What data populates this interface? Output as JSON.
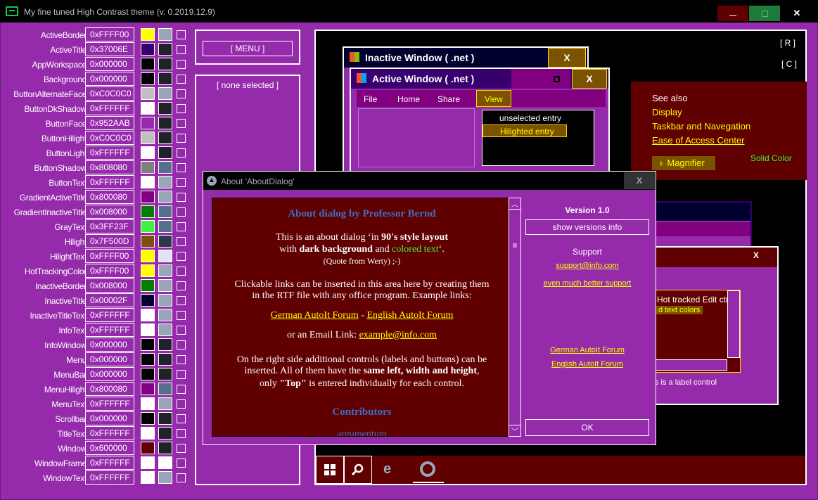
{
  "app": {
    "title": "My fine tuned High Contrast theme (v. 0.2019.12.9)"
  },
  "colors": [
    {
      "name": "ActiveBorder",
      "value": "0xFFFF00",
      "c1": "#FFFF00",
      "c2": "#9aa6b8"
    },
    {
      "name": "ActiveTitle",
      "value": "0x37006E",
      "c1": "#37006E",
      "c2": "#1f2328"
    },
    {
      "name": "AppWorkspace",
      "value": "0x000000",
      "c1": "#000000",
      "c2": "#1f2328"
    },
    {
      "name": "Background",
      "value": "0x000000",
      "c1": "#000000",
      "c2": "#1f2328"
    },
    {
      "name": "ButtonAlternateFace",
      "value": "0xC0C0C0",
      "c1": "#C0C0C0",
      "c2": "#9aa6b8"
    },
    {
      "name": "ButtonDkShadow",
      "value": "0xFFFFFF",
      "c1": "#FFFFFF",
      "c2": "#1f2328"
    },
    {
      "name": "ButtonFace",
      "value": "0x952AAB",
      "c1": "#952AAB",
      "c2": "#1f2328"
    },
    {
      "name": "ButtonHilight",
      "value": "0xC0C0C0",
      "c1": "#C0C0C0",
      "c2": "#1f2328"
    },
    {
      "name": "ButtonLight",
      "value": "0xFFFFFF",
      "c1": "#FFFFFF",
      "c2": "#1f2328"
    },
    {
      "name": "ButtonShadow",
      "value": "0x808080",
      "c1": "#808080",
      "c2": "#55708a"
    },
    {
      "name": "ButtonText",
      "value": "0xFFFFFF",
      "c1": "#FFFFFF",
      "c2": "#9aa6b8"
    },
    {
      "name": "GradientActiveTitle",
      "value": "0x800080",
      "c1": "#800080",
      "c2": "#9aa6b8"
    },
    {
      "name": "GradientInactiveTitle",
      "value": "0x008000",
      "c1": "#008000",
      "c2": "#55708a"
    },
    {
      "name": "GrayText",
      "value": "0x3FF23F",
      "c1": "#3FF23F",
      "c2": "#55708a"
    },
    {
      "name": "Hilight",
      "value": "0x7F500D",
      "c1": "#7F500D",
      "c2": "#2d3848"
    },
    {
      "name": "HilightText",
      "value": "0xFFFF00",
      "c1": "#FFFF00",
      "c2": "#dfe4ee"
    },
    {
      "name": "HotTrackingColor",
      "value": "0xFFFF00",
      "c1": "#FFFF00",
      "c2": "#9aa6b8"
    },
    {
      "name": "InactiveBorder",
      "value": "0x008000",
      "c1": "#008000",
      "c2": "#9aa6b8"
    },
    {
      "name": "InactiveTitle",
      "value": "0x00002F",
      "c1": "#00002F",
      "c2": "#9aa6b8"
    },
    {
      "name": "InactiveTitleText",
      "value": "0xFFFFFF",
      "c1": "#FFFFFF",
      "c2": "#9aa6b8"
    },
    {
      "name": "InfoText",
      "value": "0xFFFFFF",
      "c1": "#FFFFFF",
      "c2": "#9aa6b8"
    },
    {
      "name": "InfoWindow",
      "value": "0x000000",
      "c1": "#000000",
      "c2": "#1f2328"
    },
    {
      "name": "Menu",
      "value": "0x000000",
      "c1": "#000000",
      "c2": "#1f2328"
    },
    {
      "name": "MenuBar",
      "value": "0x000000",
      "c1": "#000000",
      "c2": "#1f2328"
    },
    {
      "name": "MenuHilight",
      "value": "0x800080",
      "c1": "#800080",
      "c2": "#55708a"
    },
    {
      "name": "MenuText",
      "value": "0xFFFFFF",
      "c1": "#FFFFFF",
      "c2": "#9aa6b8"
    },
    {
      "name": "Scrollbar",
      "value": "0x000000",
      "c1": "#000000",
      "c2": "#1f2328"
    },
    {
      "name": "TitleText",
      "value": "0xFFFFFF",
      "c1": "#FFFFFF",
      "c2": "#1f2328"
    },
    {
      "name": "Window",
      "value": "0x600000",
      "c1": "#600000",
      "c2": "#1f2328"
    },
    {
      "name": "WindowFrame",
      "value": "0xFFFFFF",
      "c1": "#FFFFFF",
      "c2": "#FFFFFF"
    },
    {
      "name": "WindowText",
      "value": "0xFFFFFF",
      "c1": "#FFFFFF",
      "c2": "#9aa6b8"
    }
  ],
  "menu_button": "[ MENU ]",
  "selection_label": "[ none selected ]",
  "preview": {
    "btn_r": "[ R ]",
    "btn_c": "[ C ]",
    "inactive_title": "Inactive Window ( .net )",
    "active_title": "Active Window ( .net )",
    "close_glyph": "X",
    "ribbon_tabs": [
      "File",
      "Home",
      "Share",
      "View"
    ],
    "list_unselected": "unselected entry",
    "list_highlighted": "Hilighted entry",
    "see_also": "See also",
    "links": [
      "Display",
      "Taskbar and Navegation",
      "Ease of Access Center"
    ],
    "magnifier": "Magnifier",
    "solid_color": "Solid Color",
    "edit_hot": "Hot tracked Edit ctrl.",
    "edit_colors": "d text colors",
    "label_ctrl": "s is a label control"
  },
  "about": {
    "title": "About 'AboutDialog'",
    "close": "X",
    "heading": "About dialog by Professor Bernd",
    "line1a": "This is an about dialog ‘in ",
    "line1b": "90's style layout",
    "line2a": "with ",
    "line2b": "dark background",
    "line2c": " and ",
    "line2d": "colored text",
    "line2e": "‘.",
    "quote": "(Quote from Werty)   ;-)",
    "links_p1": "Clickable links can be inserted in this area here by creating them",
    "links_p2": "in the RTF file with any office program. Example links:",
    "link_de": "German AutoIt Forum",
    "dash": " - ",
    "link_en": "English AutoIt Forum",
    "email_pre": "or an Email Link: ",
    "email": "example@info.com",
    "side1": "On the right side additional controls (labels and buttons) can be",
    "side2a": "inserted. All of them have the ",
    "side2b": "same left, width and height",
    "side2c": ",",
    "side3a": "only ",
    "side3b": "\"Top\"",
    "side3c": " is entered individually for each control.",
    "contributors": "Contributors",
    "contrib_first": "argumentum",
    "version": "Version 1.0",
    "show_versions": "show versions info",
    "support": "Support",
    "support_email": "support@info.com",
    "better_support": "even much better support",
    "side_link_de": "German AutoIt Forum",
    "side_link_en": "English AutoIt Forum",
    "ok": "OK"
  },
  "taskbar": [
    "windows-icon",
    "search-icon",
    "edge-icon",
    "chrome-icon"
  ]
}
